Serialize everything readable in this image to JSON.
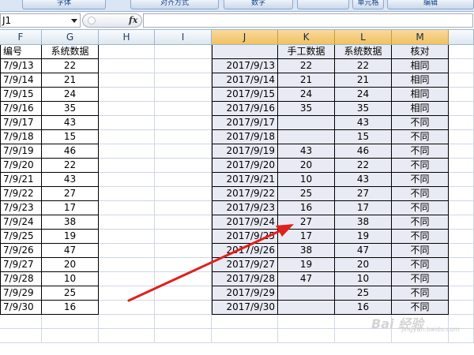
{
  "ribbon": {
    "groups": [
      "字体",
      "对齐方式",
      "数字",
      "",
      "单元格",
      "编辑"
    ]
  },
  "formula_bar": {
    "name_box": "J1",
    "fx_label": "fx",
    "formula": ""
  },
  "columns": [
    "F",
    "G",
    "H",
    "I",
    "J",
    "K",
    "L",
    "M"
  ],
  "selected_columns": [
    "J",
    "K",
    "L",
    "M"
  ],
  "left_table": {
    "headers": [
      "编号",
      "系统数据"
    ],
    "rows": [
      [
        "7/9/13",
        "22"
      ],
      [
        "7/9/14",
        "21"
      ],
      [
        "7/9/15",
        "24"
      ],
      [
        "7/9/16",
        "35"
      ],
      [
        "7/9/17",
        "43"
      ],
      [
        "7/9/18",
        "15"
      ],
      [
        "7/9/19",
        "46"
      ],
      [
        "7/9/20",
        "22"
      ],
      [
        "7/9/21",
        "43"
      ],
      [
        "7/9/22",
        "27"
      ],
      [
        "7/9/23",
        "17"
      ],
      [
        "7/9/24",
        "38"
      ],
      [
        "7/9/25",
        "19"
      ],
      [
        "7/9/26",
        "47"
      ],
      [
        "7/9/27",
        "20"
      ],
      [
        "7/9/28",
        "10"
      ],
      [
        "7/9/29",
        "25"
      ],
      [
        "7/9/30",
        "16"
      ]
    ]
  },
  "right_table": {
    "headers": [
      "",
      "手工数据",
      "系统数据",
      "核对"
    ],
    "rows": [
      [
        "2017/9/13",
        "22",
        "22",
        "相同"
      ],
      [
        "2017/9/14",
        "21",
        "21",
        "相同"
      ],
      [
        "2017/9/15",
        "24",
        "24",
        "相同"
      ],
      [
        "2017/9/16",
        "35",
        "35",
        "相同"
      ],
      [
        "2017/9/17",
        "",
        "43",
        "不同"
      ],
      [
        "2017/9/18",
        "",
        "15",
        "不同"
      ],
      [
        "2017/9/19",
        "43",
        "46",
        "不同"
      ],
      [
        "2017/9/20",
        "20",
        "22",
        "不同"
      ],
      [
        "2017/9/21",
        "10",
        "43",
        "不同"
      ],
      [
        "2017/9/22",
        "25",
        "27",
        "不同"
      ],
      [
        "2017/9/23",
        "16",
        "17",
        "不同"
      ],
      [
        "2017/9/24",
        "27",
        "38",
        "不同"
      ],
      [
        "2017/9/25",
        "17",
        "19",
        "不同"
      ],
      [
        "2017/9/26",
        "38",
        "47",
        "不同"
      ],
      [
        "2017/9/27",
        "19",
        "20",
        "不同"
      ],
      [
        "2017/9/28",
        "47",
        "10",
        "不同"
      ],
      [
        "2017/9/29",
        "",
        "25",
        "不同"
      ],
      [
        "2017/9/30",
        "",
        "16",
        "不同"
      ]
    ]
  },
  "watermark": {
    "text": "Bai 经验",
    "sub": "jingyan.baidu.com"
  },
  "colors": {
    "selection_fill": "#e8ebf3",
    "header_selected": "#f1c15f",
    "arrow": "#e0201c"
  }
}
